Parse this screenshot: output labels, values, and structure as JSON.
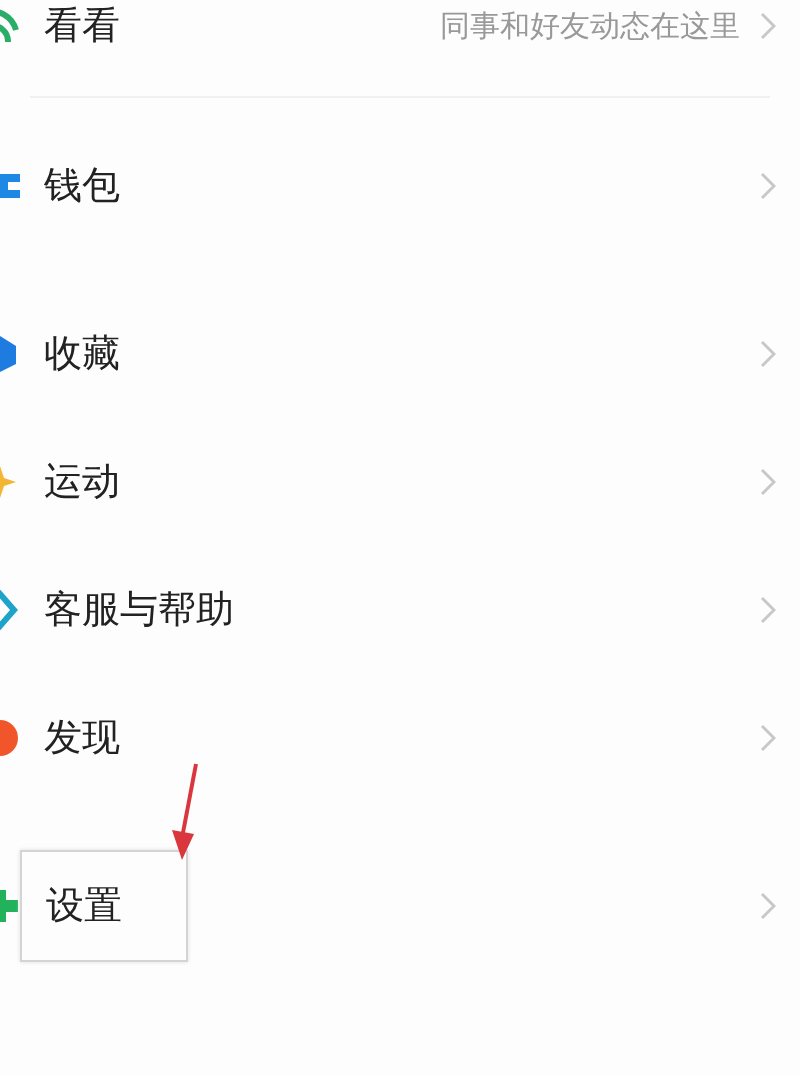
{
  "groups": [
    {
      "items": [
        {
          "label": "看看",
          "color": "#2aae67",
          "hint": "同事和好友动态在这里",
          "highlight": false
        }
      ]
    },
    {
      "items": [
        {
          "label": "钱包",
          "color": "#1e88e5",
          "highlight": false
        }
      ]
    },
    {
      "items": [
        {
          "label": "收藏",
          "color": "#1e7be0",
          "highlight": false
        },
        {
          "label": "运动",
          "color": "#f2b632",
          "highlight": false
        },
        {
          "label": "客服与帮助",
          "color": "#1fa3c9",
          "highlight": false
        },
        {
          "label": "发现",
          "color": "#f0562a",
          "highlight": false
        }
      ]
    },
    {
      "items": [
        {
          "label": "设置",
          "color": "#21b25b",
          "highlight": true
        }
      ]
    }
  ]
}
